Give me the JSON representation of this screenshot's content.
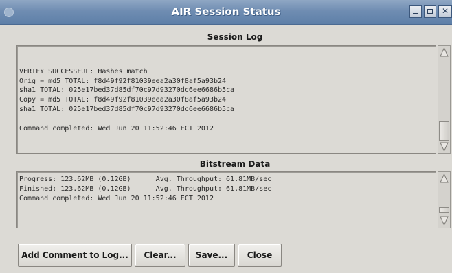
{
  "window": {
    "title": "AIR Session Status",
    "controls": {
      "minimize": "minimize-icon",
      "maximize": "maximize-icon",
      "close": "close-icon"
    }
  },
  "session_log": {
    "label": "Session Log",
    "lines": [
      "",
      "VERIFY SUCCESSFUL: Hashes match",
      "Orig = md5 TOTAL: f8d49f92f81039eea2a30f8af5a93b24",
      "sha1 TOTAL: 025e17bed37d85df70c97d93270dc6ee6686b5ca",
      "Copy = md5 TOTAL: f8d49f92f81039eea2a30f8af5a93b24",
      "sha1 TOTAL: 025e17bed37d85df70c97d93270dc6ee6686b5ca",
      "",
      "Command completed: Wed Jun 20 11:52:46 ECT 2012"
    ]
  },
  "bitstream_data": {
    "label": "Bitstream Data",
    "lines": [
      "Progress: 123.62MB (0.12GB)      Avg. Throughput: 61.81MB/sec",
      "Finished: 123.62MB (0.12GB)      Avg. Throughput: 61.81MB/sec",
      "Command completed: Wed Jun 20 11:52:46 ECT 2012"
    ]
  },
  "buttons": {
    "add_comment": "Add Comment to Log...",
    "clear": "Clear...",
    "save": "Save...",
    "close": "Close"
  }
}
